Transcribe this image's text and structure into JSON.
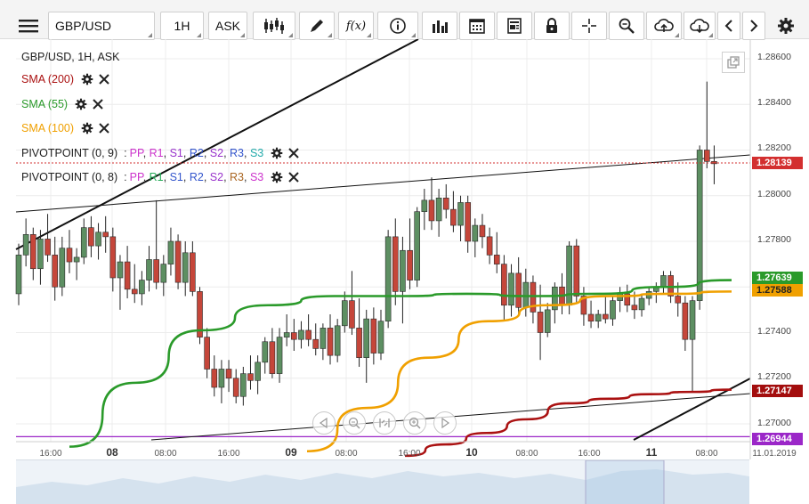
{
  "toolbar": {
    "symbol": "GBP/USD",
    "timeframe": "1H",
    "price_side": "ASK",
    "function_label": "f(x)"
  },
  "legend": {
    "title": "GBP/USD, 1H, ASK",
    "sma200": "SMA (200)",
    "sma55": "SMA (55)",
    "sma100": "SMA (100)",
    "pivot1_name": "PIVOTPOINT (0, 9)",
    "pivot2_name": "PIVOTPOINT (0, 8)",
    "pivot1_levels": [
      "PP",
      "R1",
      "S1",
      "R2",
      "S2",
      "R3",
      "S3"
    ],
    "pivot2_levels": [
      "PP",
      "R1",
      "S1",
      "R2",
      "S2",
      "R3",
      "S3"
    ],
    "pivot1_colors": [
      "#cc33cc",
      "#cc33cc",
      "#9933cc",
      "#3355cc",
      "#9933cc",
      "#3355cc",
      "#22aaaa"
    ],
    "pivot2_colors": [
      "#cc33cc",
      "#22aa55",
      "#3355cc",
      "#3355cc",
      "#9933cc",
      "#aa6622",
      "#cc33cc"
    ],
    "colors": {
      "sma200": "#aa1111",
      "sma55": "#2a9a2a",
      "sma100": "#f0a000"
    }
  },
  "price_axis": [
    "1.28600",
    "1.28400",
    "1.28200",
    "1.28000",
    "1.27800",
    "1.27400",
    "1.27200",
    "1.27000"
  ],
  "price_tags": [
    {
      "value": "1.28139",
      "color": "#d32f2f"
    },
    {
      "value": "1.27639",
      "color": "#2a9a2a"
    },
    {
      "value": "1.27588",
      "color": "#f0a000",
      "text_color": "#222"
    },
    {
      "value": "1.27147",
      "color": "#a30d0d"
    },
    {
      "value": "1.26944",
      "color": "#9b27c8"
    }
  ],
  "time_axis": {
    "labels": [
      "16:00",
      "08",
      "08:00",
      "16:00",
      "09",
      "08:00",
      "16:00",
      "10",
      "08:00",
      "16:00",
      "11",
      "08:00",
      "11.01.2019"
    ]
  },
  "chart_data": {
    "type": "candlestick",
    "symbol": "GBP/USD",
    "interval": "1H",
    "candles": [
      [
        1.2757,
        1.2779,
        1.2752,
        1.2774
      ],
      [
        1.2774,
        1.279,
        1.2769,
        1.2783
      ],
      [
        1.2783,
        1.2786,
        1.2763,
        1.2768
      ],
      [
        1.2768,
        1.2785,
        1.2761,
        1.2781
      ],
      [
        1.2781,
        1.2792,
        1.2771,
        1.2774
      ],
      [
        1.2774,
        1.2782,
        1.2754,
        1.276
      ],
      [
        1.276,
        1.2782,
        1.2756,
        1.2777
      ],
      [
        1.2777,
        1.2785,
        1.2766,
        1.2771
      ],
      [
        1.2771,
        1.2777,
        1.2763,
        1.2773
      ],
      [
        1.2773,
        1.279,
        1.277,
        1.2786
      ],
      [
        1.2786,
        1.2791,
        1.2773,
        1.2778
      ],
      [
        1.2778,
        1.2788,
        1.2772,
        1.2784
      ],
      [
        1.2784,
        1.2791,
        1.2775,
        1.2782
      ],
      [
        1.2782,
        1.2786,
        1.2758,
        1.2764
      ],
      [
        1.2764,
        1.2774,
        1.275,
        1.2771
      ],
      [
        1.2771,
        1.2778,
        1.2755,
        1.2759
      ],
      [
        1.2759,
        1.277,
        1.2753,
        1.2757
      ],
      [
        1.2757,
        1.2767,
        1.2752,
        1.2763
      ],
      [
        1.2763,
        1.2778,
        1.2758,
        1.2772
      ],
      [
        1.2772,
        1.2798,
        1.2759,
        1.2762
      ],
      [
        1.2762,
        1.2774,
        1.2756,
        1.277
      ],
      [
        1.277,
        1.2786,
        1.2765,
        1.278
      ],
      [
        1.278,
        1.2783,
        1.2759,
        1.2762
      ],
      [
        1.2762,
        1.278,
        1.2756,
        1.2775
      ],
      [
        1.2775,
        1.278,
        1.2756,
        1.2758
      ],
      [
        1.2758,
        1.276,
        1.2735,
        1.2738
      ],
      [
        1.2738,
        1.2742,
        1.272,
        1.2724
      ],
      [
        1.2724,
        1.273,
        1.2712,
        1.2716
      ],
      [
        1.2716,
        1.2728,
        1.2709,
        1.2724
      ],
      [
        1.2724,
        1.2728,
        1.2714,
        1.272
      ],
      [
        1.272,
        1.2724,
        1.2709,
        1.2712
      ],
      [
        1.2712,
        1.2725,
        1.2708,
        1.2722
      ],
      [
        1.2722,
        1.273,
        1.2715,
        1.2719
      ],
      [
        1.2719,
        1.273,
        1.2713,
        1.2727
      ],
      [
        1.2727,
        1.2738,
        1.2722,
        1.2736
      ],
      [
        1.2736,
        1.2742,
        1.272,
        1.2722
      ],
      [
        1.2722,
        1.2742,
        1.2718,
        1.2738
      ],
      [
        1.2738,
        1.2748,
        1.2734,
        1.274
      ],
      [
        1.274,
        1.2746,
        1.2732,
        1.2737
      ],
      [
        1.2737,
        1.2745,
        1.2733,
        1.2741
      ],
      [
        1.2741,
        1.2748,
        1.2734,
        1.2737
      ],
      [
        1.2737,
        1.2744,
        1.273,
        1.2733
      ],
      [
        1.2733,
        1.2744,
        1.2728,
        1.2742
      ],
      [
        1.2742,
        1.2748,
        1.2726,
        1.273
      ],
      [
        1.273,
        1.2746,
        1.2727,
        1.2743
      ],
      [
        1.2743,
        1.2758,
        1.274,
        1.2754
      ],
      [
        1.2754,
        1.2767,
        1.2739,
        1.2742
      ],
      [
        1.2742,
        1.2755,
        1.2725,
        1.2729
      ],
      [
        1.2729,
        1.275,
        1.2718,
        1.2746
      ],
      [
        1.2746,
        1.2751,
        1.2726,
        1.2731
      ],
      [
        1.2731,
        1.275,
        1.2728,
        1.2745
      ],
      [
        1.2745,
        1.2785,
        1.2742,
        1.2782
      ],
      [
        1.2782,
        1.279,
        1.2752,
        1.2758
      ],
      [
        1.2758,
        1.2782,
        1.2744,
        1.2776
      ],
      [
        1.2776,
        1.279,
        1.2759,
        1.2763
      ],
      [
        1.2763,
        1.2795,
        1.276,
        1.2793
      ],
      [
        1.2793,
        1.2803,
        1.2785,
        1.2798
      ],
      [
        1.2798,
        1.2808,
        1.2785,
        1.2789
      ],
      [
        1.2789,
        1.2803,
        1.2782,
        1.2799
      ],
      [
        1.2799,
        1.2805,
        1.279,
        1.2794
      ],
      [
        1.2794,
        1.2802,
        1.2784,
        1.2787
      ],
      [
        1.2787,
        1.28,
        1.278,
        1.2797
      ],
      [
        1.2797,
        1.28,
        1.2775,
        1.278
      ],
      [
        1.278,
        1.279,
        1.2773,
        1.2787
      ],
      [
        1.2787,
        1.2792,
        1.2777,
        1.2782
      ],
      [
        1.2782,
        1.2786,
        1.277,
        1.2774
      ],
      [
        1.2774,
        1.2784,
        1.2766,
        1.277
      ],
      [
        1.277,
        1.2774,
        1.2745,
        1.2752
      ],
      [
        1.2752,
        1.277,
        1.2747,
        1.2766
      ],
      [
        1.2766,
        1.2773,
        1.2748,
        1.2751
      ],
      [
        1.2751,
        1.2768,
        1.2747,
        1.2762
      ],
      [
        1.2762,
        1.2765,
        1.2744,
        1.2749
      ],
      [
        1.2749,
        1.2761,
        1.2728,
        1.274
      ],
      [
        1.274,
        1.2753,
        1.2738,
        1.275
      ],
      [
        1.275,
        1.2762,
        1.2744,
        1.276
      ],
      [
        1.276,
        1.2766,
        1.2748,
        1.2752
      ],
      [
        1.2752,
        1.278,
        1.2748,
        1.2778
      ],
      [
        1.2778,
        1.2781,
        1.2753,
        1.2756
      ],
      [
        1.2756,
        1.276,
        1.2743,
        1.2748
      ],
      [
        1.2748,
        1.2754,
        1.2742,
        1.2745
      ],
      [
        1.2745,
        1.275,
        1.2742,
        1.2748
      ],
      [
        1.2748,
        1.2756,
        1.2744,
        1.2746
      ],
      [
        1.2746,
        1.2756,
        1.2743,
        1.2754
      ],
      [
        1.2754,
        1.276,
        1.2749,
        1.2757
      ],
      [
        1.2757,
        1.2761,
        1.2749,
        1.2752
      ],
      [
        1.2752,
        1.2758,
        1.2746,
        1.275
      ],
      [
        1.275,
        1.2757,
        1.2747,
        1.2755
      ],
      [
        1.2755,
        1.276,
        1.2752,
        1.2758
      ],
      [
        1.2758,
        1.2762,
        1.2753,
        1.276
      ],
      [
        1.276,
        1.2767,
        1.2757,
        1.2765
      ],
      [
        1.2765,
        1.2767,
        1.2753,
        1.2756
      ],
      [
        1.2756,
        1.2762,
        1.2747,
        1.2753
      ],
      [
        1.2753,
        1.2756,
        1.2732,
        1.2737
      ],
      [
        1.2737,
        1.2756,
        1.2714,
        1.2754
      ],
      [
        1.2754,
        1.2822,
        1.275,
        1.282
      ],
      [
        1.282,
        1.285,
        1.2812,
        1.2815
      ],
      [
        1.2815,
        1.2822,
        1.2805,
        1.2814
      ]
    ],
    "sma200": [
      1.2686,
      1.2691,
      1.2696,
      1.2702,
      1.2709,
      1.2711,
      1.2713,
      1.2714,
      1.2715
    ],
    "sma55": [
      1.269,
      1.2718,
      1.2741,
      1.2752,
      1.2756,
      1.2756,
      1.2757,
      1.2756,
      1.2757,
      1.276,
      1.2763
    ],
    "sma100": [
      1.2688,
      1.2707,
      1.2729,
      1.2745,
      1.2752,
      1.2756,
      1.2757,
      1.2758
    ],
    "pivot_levels": [
      1.2817,
      1.26944
    ]
  }
}
